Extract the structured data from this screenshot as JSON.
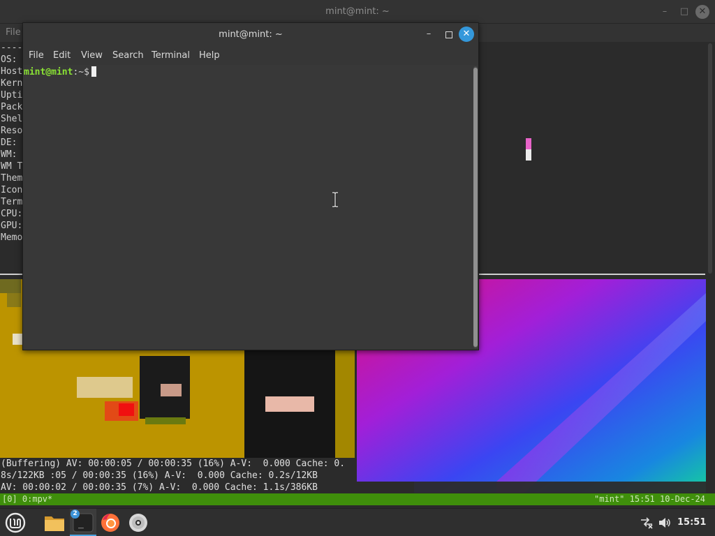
{
  "background_window": {
    "title": "mint@mint: ~",
    "menu_file": "File",
    "fetch_separator": "-----",
    "fetch_labels": [
      "OS:",
      "Host",
      "Kern",
      "Upti",
      "Pack",
      "Shel",
      "Reso",
      "DE:",
      "WM:",
      "WM T",
      "Them",
      "Icon",
      "Term",
      "CPU:",
      "GPU:",
      "Memo"
    ]
  },
  "mpv": {
    "status_lines": [
      "(Buffering) AV: 00:00:05 / 00:00:35 (16%) A-V:  0.000 Cache: 0.",
      "8s/122KB :05 / 00:00:35 (16%) A-V:  0.000 Cache: 0.2s/12KB",
      "AV: 00:00:02 / 00:00:35 (7%) A-V:  0.000 Cache: 1.1s/386KB"
    ]
  },
  "tmux": {
    "left": "[0] 0:mpv*",
    "right": "\"mint\" 15:51 10-Dec-24"
  },
  "terminal": {
    "title": "mint@mint: ~",
    "menu": [
      "File",
      "Edit",
      "View",
      "Search",
      "Terminal",
      "Help"
    ],
    "prompt_user": "mint@mint",
    "prompt_path": ":~$"
  },
  "taskbar": {
    "terminal_badge": "2",
    "terminal_glyph": "_",
    "clock": "15:51"
  },
  "colors": {
    "accent": "#3498db",
    "prompt_green": "#8ae234",
    "tmux_green": "#3f8f0b",
    "video_gold": "#bc9400"
  }
}
